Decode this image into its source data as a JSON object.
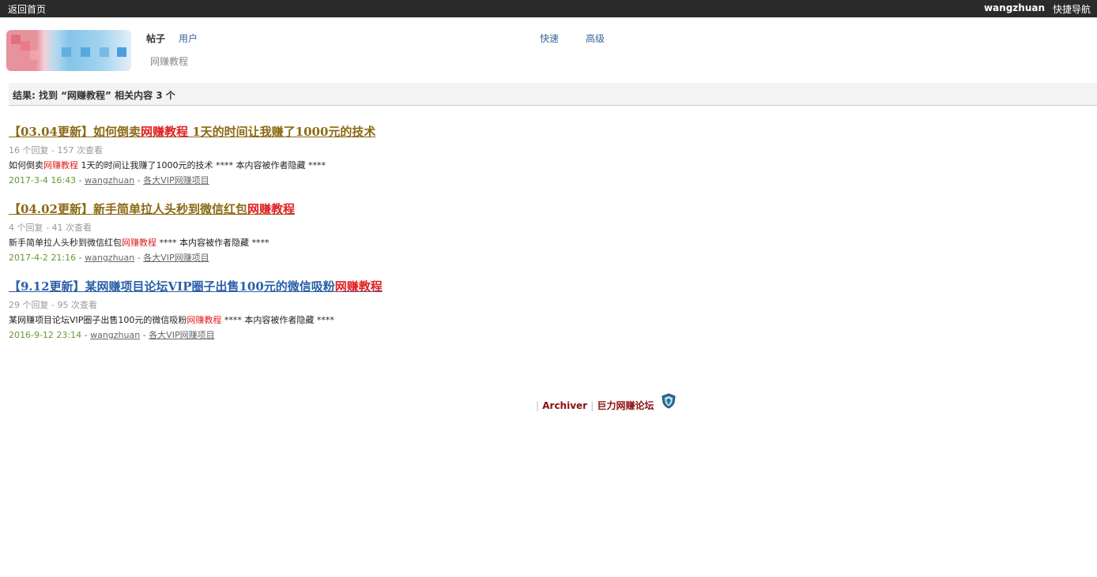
{
  "topbar": {
    "home_label": "返回首页",
    "username": "wangzhuan",
    "quicknav_label": "快捷导航"
  },
  "header": {
    "logo_name": "site-logo (blurred)",
    "tabs": [
      {
        "label": "帖子",
        "active": true
      },
      {
        "label": "用户",
        "active": false
      }
    ],
    "search_value": "网赚教程",
    "quick_label": "快速",
    "advanced_label": "高级"
  },
  "results": {
    "summary": "结果: 找到 “网赚教程” 相关内容 3 个",
    "items": [
      {
        "title_prefix": "【03.04更新】如何倒卖",
        "title_highlight": "网赚教程",
        "title_suffix": " 1天的时间让我赚了1000元的技术",
        "title_color": "#8b6914",
        "stats": "16 个回复 - 157 次查看",
        "snippet_prefix": "如何倒卖",
        "snippet_highlight": "网赚教程",
        "snippet_suffix": " 1天的时间让我赚了1000元的技术 **** 本内容被作者隐藏 ****",
        "date": "2017-3-4 16:43",
        "author": "wangzhuan",
        "forum": "各大VIP网赚项目"
      },
      {
        "title_prefix": "【04.02更新】新手简单拉人头秒到微信红包",
        "title_highlight": "网赚教程",
        "title_suffix": "",
        "title_color": "#8b6914",
        "stats": "4 个回复 - 41 次查看",
        "snippet_prefix": "新手简单拉人头秒到微信红包",
        "snippet_highlight": "网赚教程",
        "snippet_suffix": " **** 本内容被作者隐藏 ****",
        "date": "2017-4-2 21:16",
        "author": "wangzhuan",
        "forum": "各大VIP网赚项目"
      },
      {
        "title_prefix": "【9.12更新】某网赚项目论坛VIP圈子出售100元的微信吸粉",
        "title_highlight": "网赚教程",
        "title_suffix": "",
        "title_color": "#2a5fa8",
        "stats": "29 个回复 - 95 次查看",
        "snippet_prefix": "某网赚项目论坛VIP圈子出售100元的微信吸粉",
        "snippet_highlight": "网赚教程",
        "snippet_suffix": " **** 本内容被作者隐藏 ****",
        "date": "2016-9-12 23:14",
        "author": "wangzhuan",
        "forum": "各大VIP网赚项目"
      }
    ]
  },
  "footer": {
    "archiver_label": "Archiver",
    "site_label": "巨力网赚论坛",
    "badge_icon": "security-shield-icon"
  },
  "colors": {
    "topbar_bg": "#2b2b2b",
    "highlight": "#e02020",
    "footer_link": "#8b1010",
    "date_green": "#669933"
  }
}
